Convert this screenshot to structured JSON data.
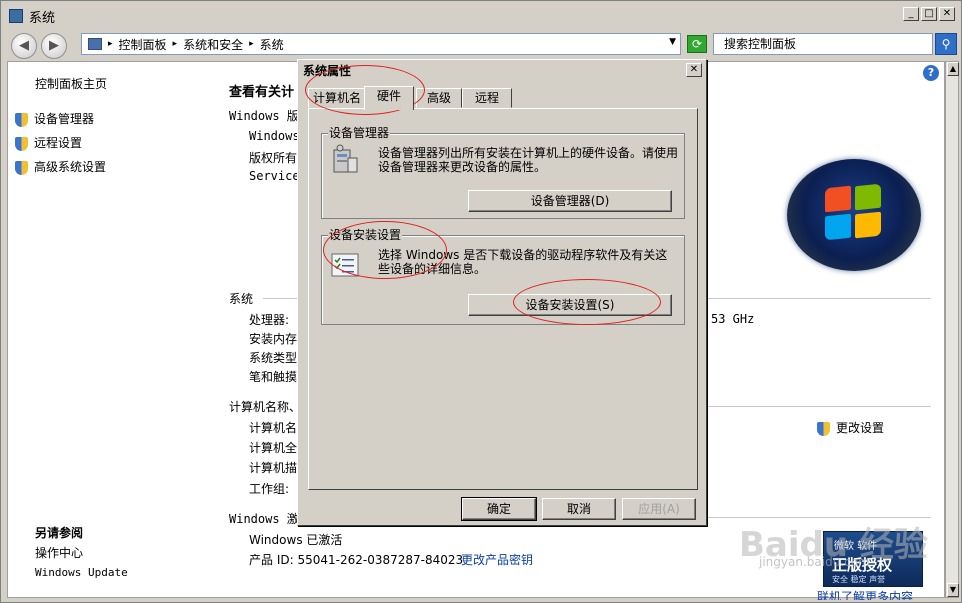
{
  "window": {
    "title": "系统",
    "min": "_",
    "max": "□",
    "close": "✕"
  },
  "navbar": {
    "back": "◀",
    "forward": "▶",
    "breadcrumbs": [
      "控制面板",
      "系统和安全",
      "系统"
    ],
    "separator": "▸",
    "search_placeholder": "搜索控制面板"
  },
  "sidebar": {
    "home": "控制面板主页",
    "items": [
      "设备管理器",
      "远程设置",
      "高级系统设置"
    ],
    "see_also_title": "另请参阅",
    "see_also": [
      "操作中心",
      "Windows Update"
    ]
  },
  "main": {
    "heading": "查看有关计",
    "edition_label": "Windows 版本",
    "edition_lines": [
      "Windows",
      "版权所有",
      "Service"
    ],
    "system_label": "系统",
    "system_rows": [
      "处理器:",
      "安装内存",
      "系统类型",
      "笔和触摸"
    ],
    "cpu_speed": "53 GHz",
    "computer_label": "计算机名称、",
    "computer_rows": [
      "计算机名",
      "计算机全",
      "计算机描",
      "工作组:"
    ],
    "change_settings": "更改设置",
    "activation_label": "Windows 激活",
    "activated": "Windows 已激活",
    "product_id": "产品 ID: 55041-262-0387287-84023",
    "change_key": "更改产品密钥",
    "genuine_badge": {
      "line1": "微软 软件",
      "line2": "正版授权",
      "line3": "安全 稳定 声誉"
    },
    "learn_more": "联机了解更多内容"
  },
  "dialog": {
    "title": "系统属性",
    "close": "✕",
    "tabs": [
      "计算机名",
      "硬件",
      "高级",
      "远程"
    ],
    "active_tab": 1,
    "device_manager_group": "设备管理器",
    "device_manager_text": "设备管理器列出所有安装在计算机上的硬件设备。请使用设备管理器来更改设备的属性。",
    "device_manager_button": "设备管理器(D)",
    "install_group": "设备安装设置",
    "install_text": "选择 Windows 是否下载设备的驱动程序软件及有关这些设备的详细信息。",
    "install_button": "设备安装设置(S)",
    "ok": "确定",
    "cancel": "取消",
    "apply": "应用(A)"
  },
  "watermark": {
    "main": "Baidu 经验",
    "sub": "jingyan.baidu.com"
  }
}
